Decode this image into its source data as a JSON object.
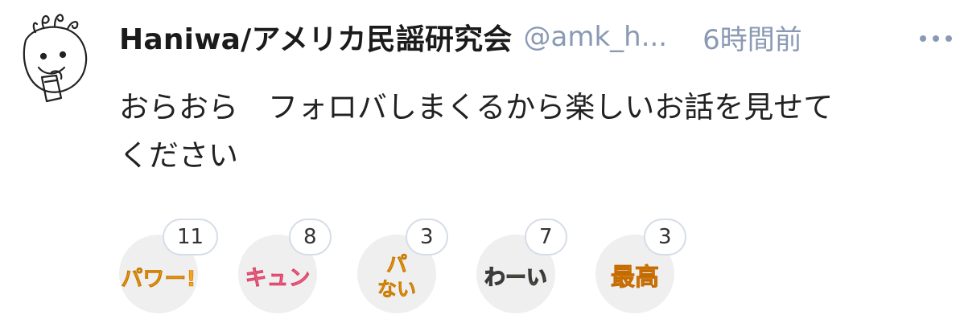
{
  "post": {
    "author_name": "Haniwa/アメリカ民謡研究会",
    "handle": "@amk_h...",
    "time": "6時間前",
    "more_icon": "more-horizontal-icon",
    "body": "おらおら　フォロバしまくるから楽しいお話を見せて\nください"
  },
  "reactions": [
    {
      "label": "パワー!",
      "icon": "power-stamp-icon",
      "count": "11",
      "color": "#f7a21b"
    },
    {
      "label": "キュン",
      "icon": "kyun-stamp-icon",
      "count": "8",
      "color": "#f2738f"
    },
    {
      "label": "パ ない",
      "icon": "panai-stamp-icon",
      "count": "3",
      "color": "#f5a623"
    },
    {
      "label": "わーい",
      "icon": "waai-stamp-icon",
      "count": "7",
      "color": "#f2c21b"
    },
    {
      "label": "最高",
      "icon": "saikou-stamp-icon",
      "count": "3",
      "color": "#f59a1b"
    }
  ]
}
